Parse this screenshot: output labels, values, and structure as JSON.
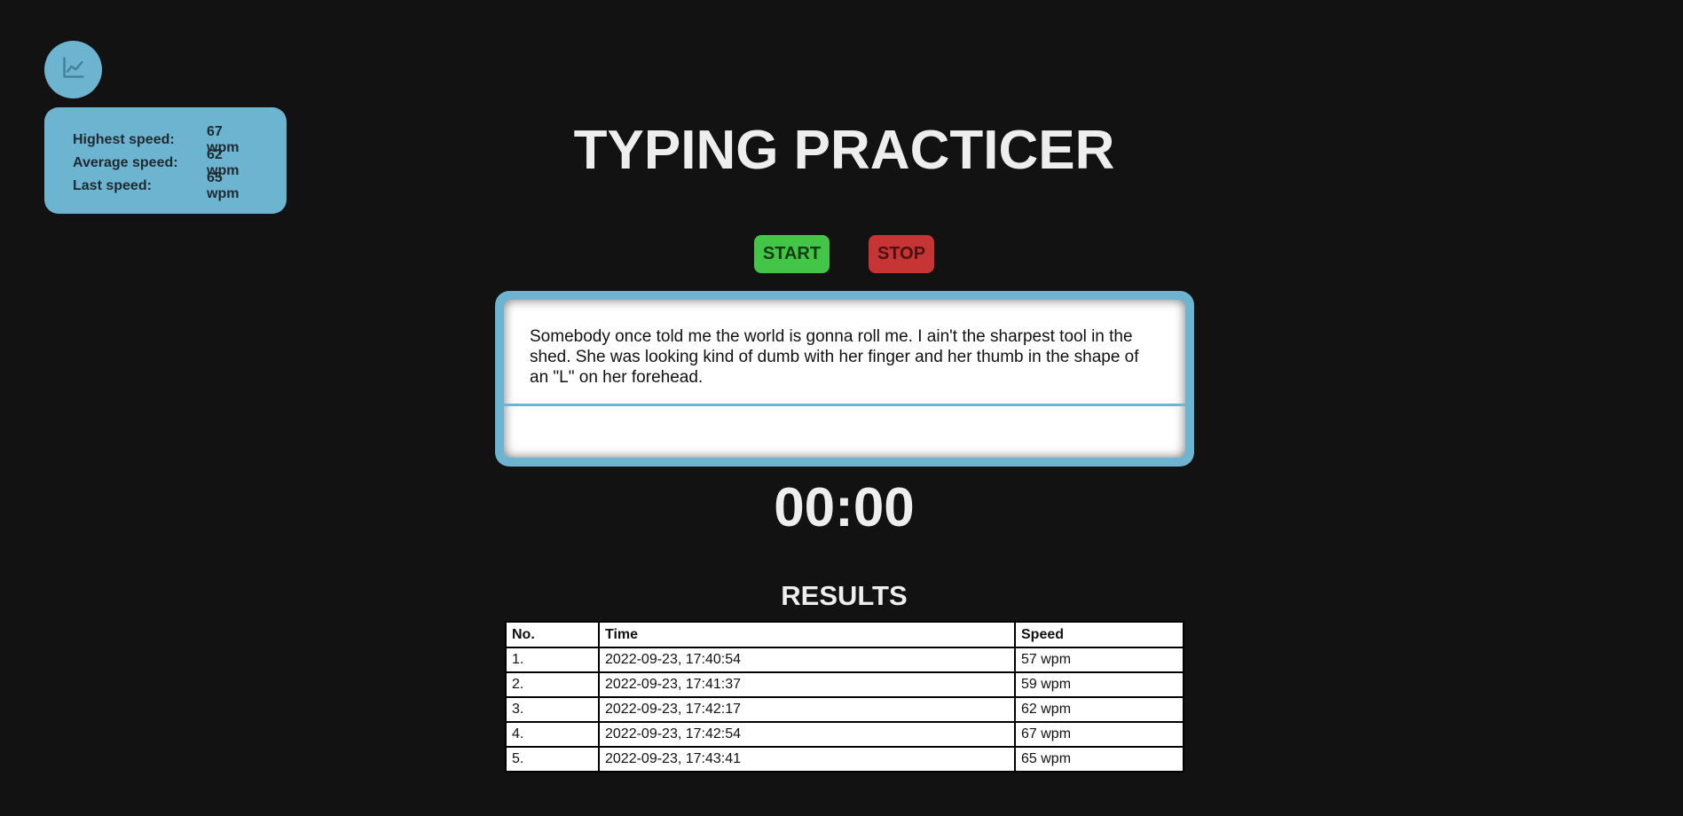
{
  "stats": {
    "toggle_icon": "line-chart-icon",
    "rows": [
      {
        "label": "Highest speed:",
        "value": "67 wpm"
      },
      {
        "label": "Average speed:",
        "value": "62 wpm"
      },
      {
        "label": "Last speed:",
        "value": "65 wpm"
      }
    ]
  },
  "title": "TYPING PRACTICER",
  "controls": {
    "start_label": "START",
    "stop_label": "STOP"
  },
  "quote": "Somebody once told me the world is gonna roll me. I ain't the sharpest tool in the shed. She was looking kind of dumb with her finger and her thumb in the shape of an \"L\" on her forehead.",
  "typing_input": {
    "value": ""
  },
  "timer": "00:00",
  "results": {
    "title": "RESULTS",
    "headers": [
      "No.",
      "Time",
      "Speed"
    ],
    "rows": [
      [
        "1.",
        "2022-09-23, 17:40:54",
        "57 wpm"
      ],
      [
        "2.",
        "2022-09-23, 17:41:37",
        "59 wpm"
      ],
      [
        "3.",
        "2022-09-23, 17:42:17",
        "62 wpm"
      ],
      [
        "4.",
        "2022-09-23, 17:42:54",
        "67 wpm"
      ],
      [
        "5.",
        "2022-09-23, 17:43:41",
        "65 wpm"
      ]
    ]
  },
  "colors": {
    "background": "#121212",
    "accent": "#6db4d1",
    "start": "#43c548",
    "stop": "#c73434"
  }
}
